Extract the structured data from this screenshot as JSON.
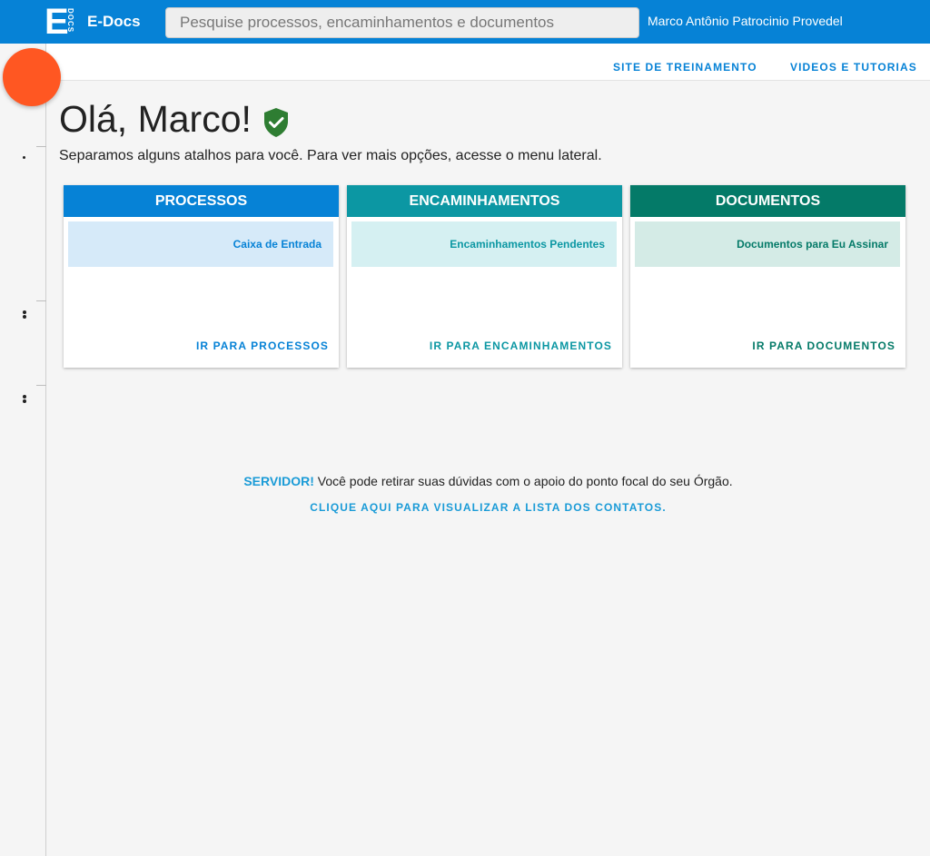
{
  "header": {
    "logo_letter": "E",
    "logo_sub": "DOCS",
    "brand": "E-Docs",
    "search_placeholder": "Pesquise processos, encaminhamentos e documentos",
    "user_name": "Marco Antônio Patrocinio Provedel",
    "color": "#0682d6"
  },
  "toplinks": {
    "training": "SITE DE TREINAMENTO",
    "videos": "VIDEOS E TUTORIAS"
  },
  "greeting": {
    "title": "Olá, Marco!",
    "subtitle": "Separamos alguns atalhos para você. Para ver mais opções, acesse o menu lateral."
  },
  "cards": [
    {
      "title": "PROCESSOS",
      "item": "Caixa de Entrada",
      "link": "IR PARA PROCESSOS",
      "head_color": "#0682d6",
      "item_bg": "#d6eaf9",
      "item_color": "#0682d6"
    },
    {
      "title": "ENCAMINHAMENTOS",
      "item": "Encaminhamentos Pendentes",
      "link": "IR PARA ENCAMINHAMENTOS",
      "head_color": "#0c97a3",
      "item_bg": "#d5f0f2",
      "item_color": "#0c97a3"
    },
    {
      "title": "DOCUMENTOS",
      "item": "Documentos para Eu Assinar",
      "link": "IR PARA DOCUMENTOS",
      "head_color": "#047a68",
      "item_bg": "#d4ebe6",
      "item_color": "#047a68"
    }
  ],
  "notice": {
    "label": "SERVIDOR!",
    "text": "Você pode retirar suas dúvidas com o apoio do ponto focal do seu Órgão.",
    "link": "CLIQUE AQUI PARA VISUALIZAR A LISTA DOS CONTATOS."
  },
  "fab_color": "#ff5722"
}
